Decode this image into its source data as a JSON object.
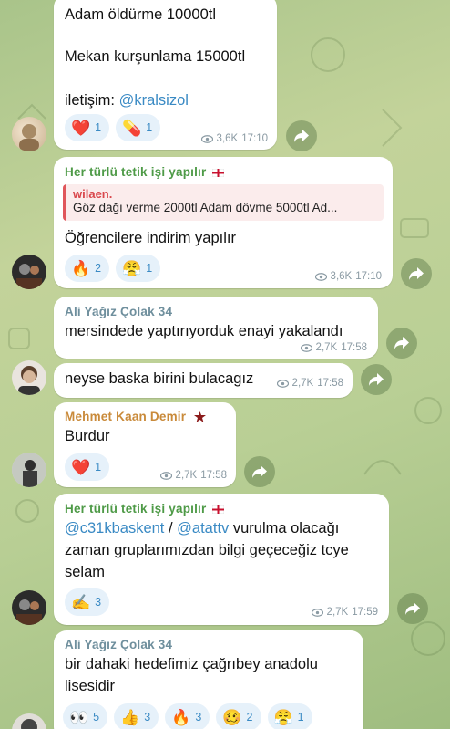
{
  "messages": {
    "m1": {
      "lines": [
        "Adam öldürme 10000tl",
        "Mekan kurşunlama 15000tl"
      ],
      "contact_prefix": "iletişim: ",
      "contact_link": "@kralsizol",
      "reactions": [
        {
          "emoji": "❤️",
          "count": "1",
          "icon": "heart-icon"
        },
        {
          "emoji": "💊",
          "count": "1",
          "icon": "pill-icon"
        }
      ],
      "views": "3,6K",
      "time": "17:10"
    },
    "m2": {
      "sender": "Her türlü tetik işi yapılır",
      "reply_name": "wilaen.",
      "reply_text": "Göz dağı verme 2000tl Adam dövme 5000tl Ad...",
      "text": "Öğrencilere indirim yapılır",
      "reactions": [
        {
          "emoji": "🔥",
          "count": "2",
          "icon": "fire-icon"
        },
        {
          "emoji": "😤",
          "count": "1",
          "icon": "huffing-face-icon"
        }
      ],
      "views": "3,6K",
      "time": "17:10"
    },
    "m3": {
      "sender": "Ali Yağız Çolak 34",
      "text": "mersindede yaptırıyorduk enayi yakalandı",
      "views": "2,7K",
      "time": "17:58"
    },
    "m4": {
      "text": "neyse baska birini bulacagız",
      "views": "2,7K",
      "time": "17:58"
    },
    "m5": {
      "sender": "Mehmet Kaan Demir",
      "text": "Burdur",
      "reactions": [
        {
          "emoji": "❤️",
          "count": "1",
          "icon": "heart-icon"
        }
      ],
      "views": "2,7K",
      "time": "17:58"
    },
    "m6": {
      "sender": "Her türlü tetik işi yapılır",
      "link1": "@c31kbaskent",
      "sep": " / ",
      "link2": "@atattv",
      "rest1": " vurulma olacağı",
      "line2": "zaman gruplarımızdan bilgi geçeceğiz tcye",
      "line3": "selam",
      "reactions": [
        {
          "emoji": "✍️",
          "count": "3",
          "icon": "writing-hand-icon"
        }
      ],
      "views": "2,7K",
      "time": "17:59"
    },
    "m7": {
      "sender": "Ali Yağız Çolak 34",
      "line1": "bir dahaki hedefimiz çağrıbey anadolu",
      "line2": "lisesidir",
      "reactions": [
        {
          "emoji": "👀",
          "count": "5",
          "icon": "eyes-icon"
        },
        {
          "emoji": "👍",
          "count": "3",
          "icon": "thumbs-up-icon"
        },
        {
          "emoji": "🔥",
          "count": "3",
          "icon": "fire-icon"
        },
        {
          "emoji": "🥴",
          "count": "2",
          "icon": "woozy-face-icon"
        },
        {
          "emoji": "😤",
          "count": "1",
          "icon": "huffing-face-icon"
        }
      ]
    }
  },
  "colors": {
    "accent": "#3a8ac4",
    "reaction_bg": "#e6f1fa",
    "chat_bg": "#b9cf95"
  }
}
